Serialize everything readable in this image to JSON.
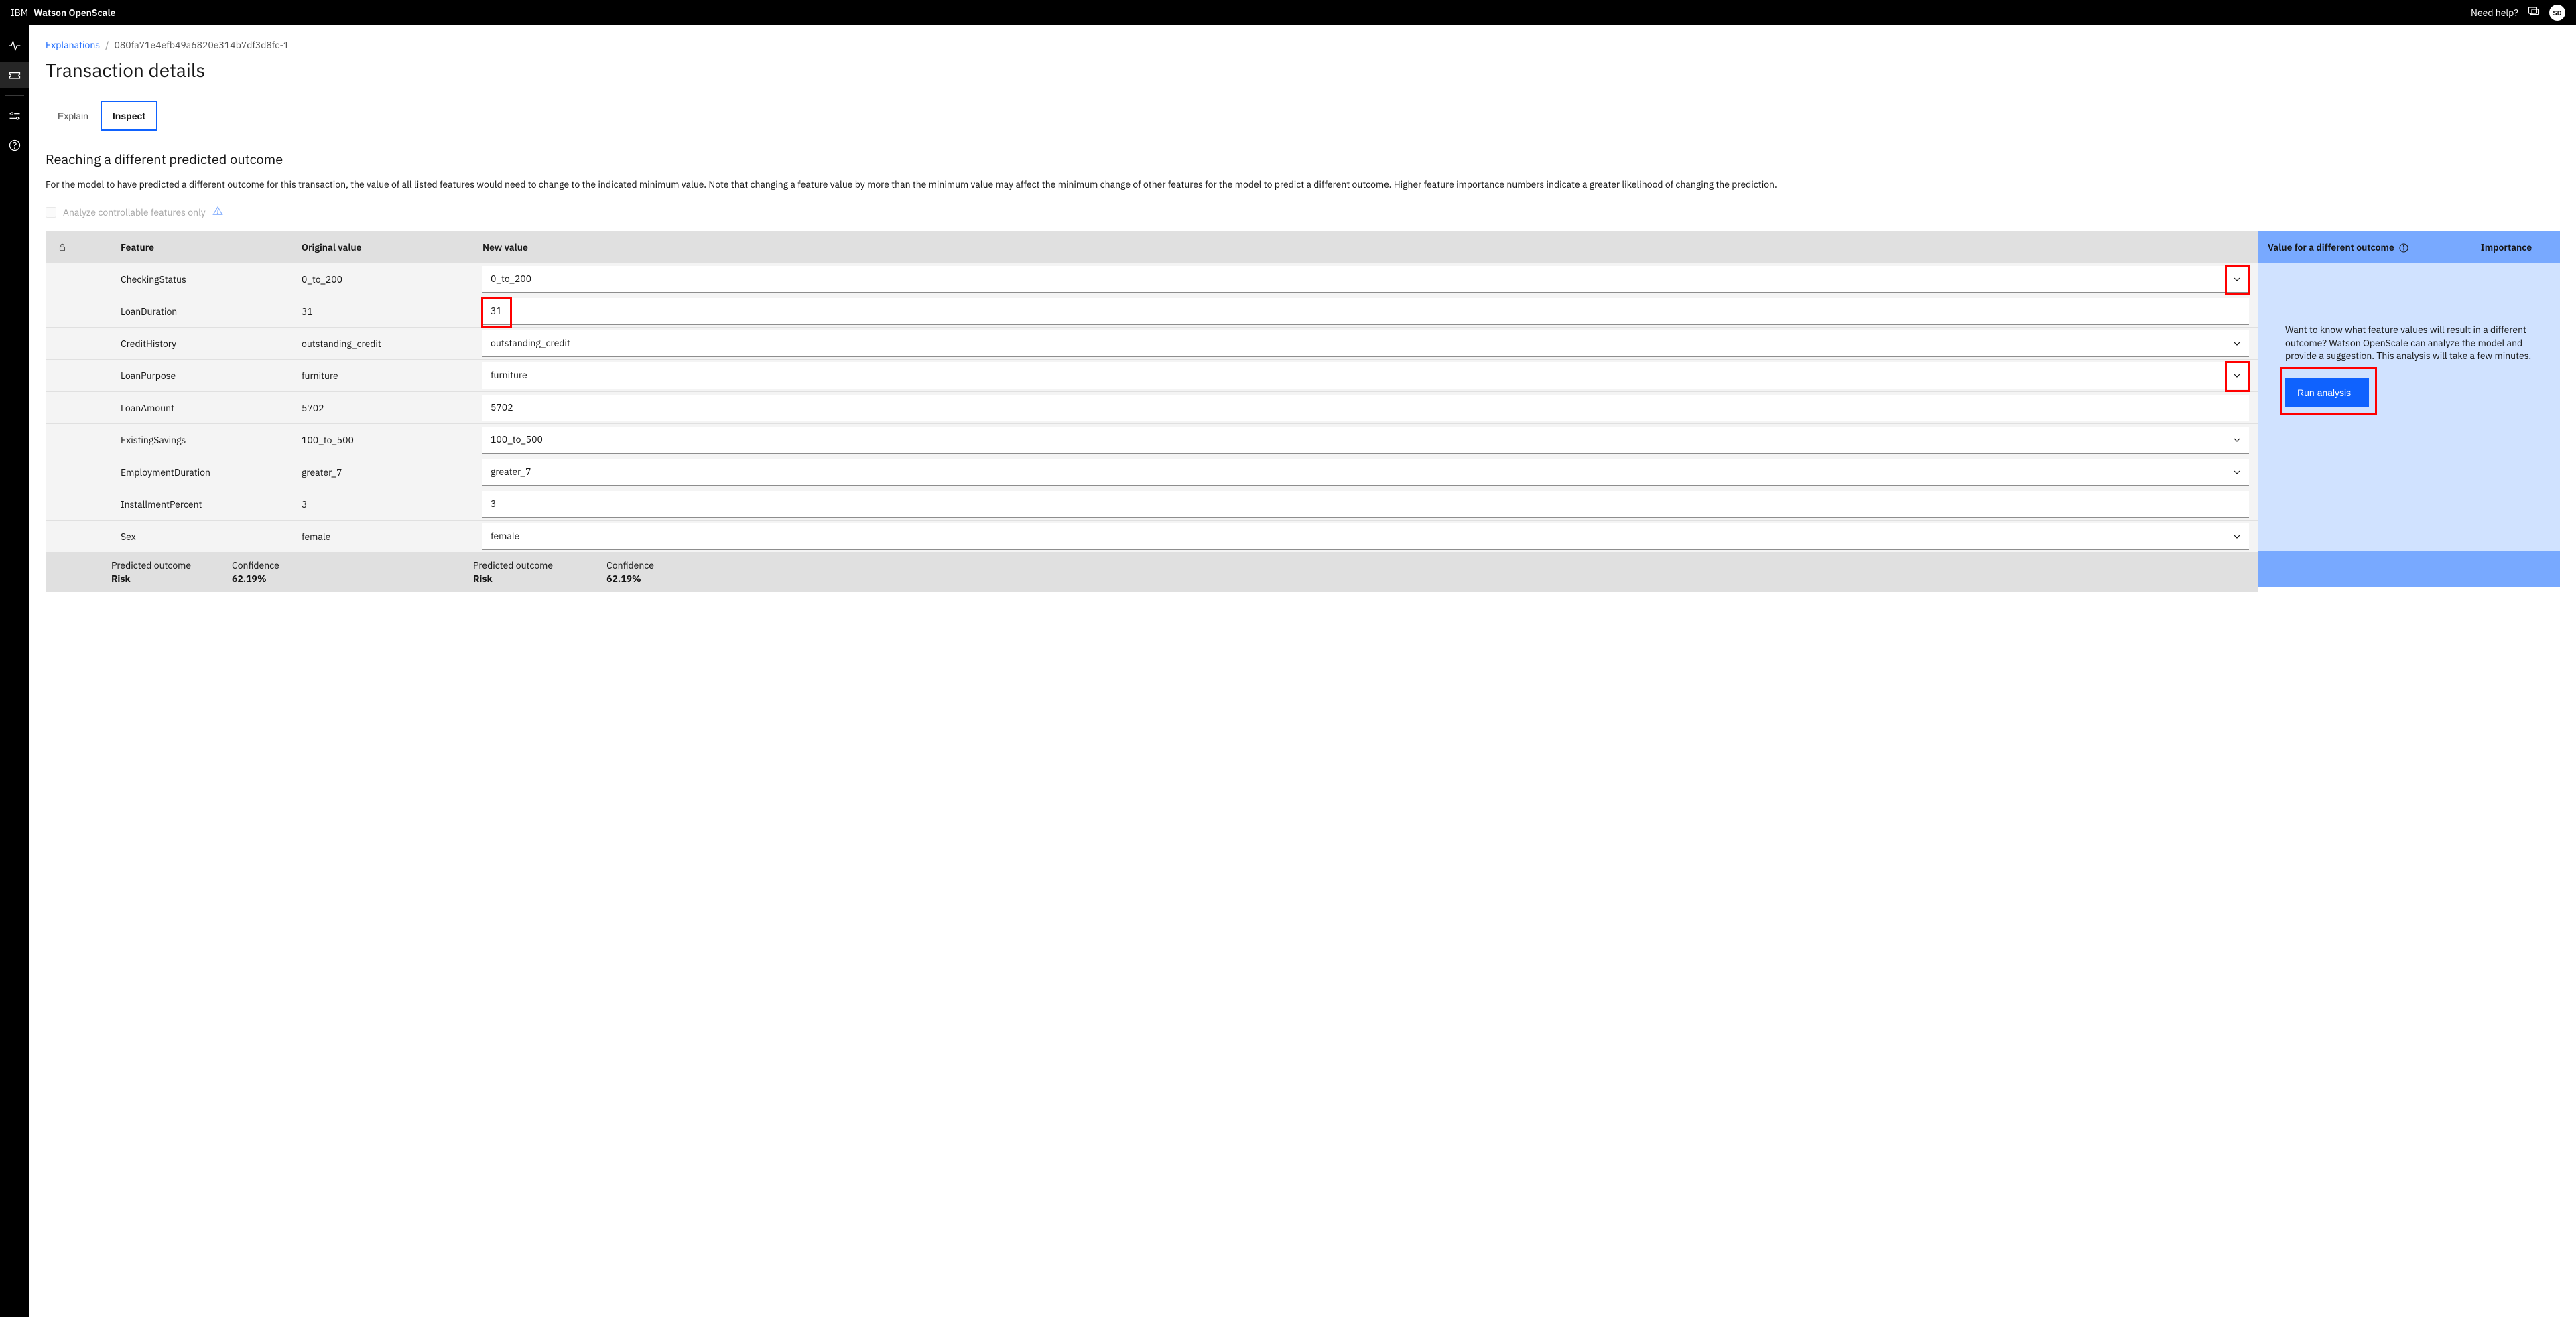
{
  "header": {
    "brand_ibm": "IBM",
    "brand_product": "Watson OpenScale",
    "help": "Need help?",
    "avatar": "SD"
  },
  "breadcrumb": {
    "root": "Explanations",
    "sep": "/",
    "current": "080fa71e4efb49a6820e314b7df3d8fc-1"
  },
  "page_title": "Transaction details",
  "tabs": {
    "explain": "Explain",
    "inspect": "Inspect"
  },
  "section_title": "Reaching a different predicted outcome",
  "description": "For the model to have predicted a different outcome for this transaction, the value of all listed features would need to change to the indicated minimum value. Note that changing a feature value by more than the minimum value may affect the minimum change of other features for the model to predict a different outcome. Higher feature importance numbers indicate a greater likelihood of changing the prediction.",
  "checkbox_label": "Analyze controllable features only",
  "columns": {
    "feature": "Feature",
    "original": "Original value",
    "newval": "New value",
    "diff": "Value for a different outcome",
    "importance": "Importance"
  },
  "rows": [
    {
      "feature": "CheckingStatus",
      "original": "0_to_200",
      "newval": "0_to_200",
      "kind": "select",
      "hl": "chev"
    },
    {
      "feature": "LoanDuration",
      "original": "31",
      "newval": "31",
      "kind": "number",
      "hl": "val"
    },
    {
      "feature": "CreditHistory",
      "original": "outstanding_credit",
      "newval": "outstanding_credit",
      "kind": "select",
      "hl": ""
    },
    {
      "feature": "LoanPurpose",
      "original": "furniture",
      "newval": "furniture",
      "kind": "select",
      "hl": "chev"
    },
    {
      "feature": "LoanAmount",
      "original": "5702",
      "newval": "5702",
      "kind": "number",
      "hl": ""
    },
    {
      "feature": "ExistingSavings",
      "original": "100_to_500",
      "newval": "100_to_500",
      "kind": "select",
      "hl": ""
    },
    {
      "feature": "EmploymentDuration",
      "original": "greater_7",
      "newval": "greater_7",
      "kind": "select",
      "hl": ""
    },
    {
      "feature": "InstallmentPercent",
      "original": "3",
      "newval": "3",
      "kind": "number",
      "hl": ""
    },
    {
      "feature": "Sex",
      "original": "female",
      "newval": "female",
      "kind": "select",
      "hl": ""
    }
  ],
  "footer": {
    "left": {
      "label1": "Predicted outcome",
      "value1": "Risk",
      "label2": "Confidence",
      "value2": "62.19%"
    },
    "right": {
      "label1": "Predicted outcome",
      "value1": "Risk",
      "label2": "Confidence",
      "value2": "62.19%"
    }
  },
  "right_panel": {
    "hint": "Want to know what feature values will result in a different outcome? Watson OpenScale can analyze the model and provide a suggestion. This analysis will take a few minutes.",
    "button": "Run analysis"
  }
}
